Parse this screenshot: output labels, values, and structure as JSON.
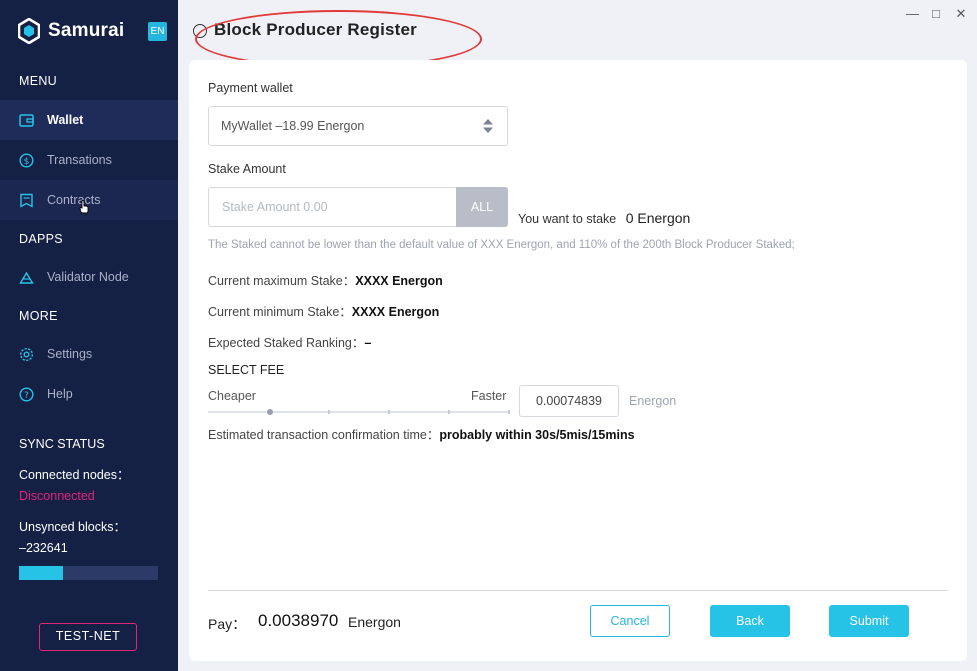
{
  "app": {
    "name": "Samurai",
    "lang": "EN"
  },
  "sidebar": {
    "menu_title": "MENU",
    "menu_items": [
      {
        "label": "Wallet",
        "icon": "wallet-icon"
      },
      {
        "label": "Transations",
        "icon": "dollar-circle-icon"
      },
      {
        "label": "Contracts",
        "icon": "contract-icon"
      }
    ],
    "dapps_title": "DAPPS",
    "dapps_items": [
      {
        "label": "Validator Node",
        "icon": "validator-icon"
      }
    ],
    "more_title": "MORE",
    "more_items": [
      {
        "label": "Settings",
        "icon": "gear-icon"
      },
      {
        "label": "Help",
        "icon": "help-icon"
      }
    ],
    "sync": {
      "title": "SYNC STATUS",
      "connected_label": "Connected nodes：",
      "connected_value": "Disconnected",
      "unsynced_label": "Unsynced blocks：",
      "unsynced_value": "–232641",
      "progress": 0.32
    },
    "network_button": "TEST-NET"
  },
  "page": {
    "title": "Block Producer Register"
  },
  "form": {
    "payment_wallet_label": "Payment wallet",
    "wallet_select_value": "MyWallet –18.99 Energon",
    "stake_amount_label": "Stake Amount",
    "stake_placeholder": "Stake Amount 0.00",
    "all_button": "ALL",
    "want_to_stake_label": "You want to stake",
    "want_to_stake_value": "0 Energon",
    "hint": "The Staked cannot be lower than the default value of XXX Energon, and 110% of the 200th Block Producer Staked;",
    "max_stake_label": "Current maximum Stake：",
    "max_stake_value": "XXXX Energon",
    "min_stake_label": "Current minimum Stake：",
    "min_stake_value": "XXXX Energon",
    "ranking_label": "Expected Staked Ranking：",
    "ranking_value": "–",
    "select_fee_label": "SELECT FEE",
    "cheaper_label": "Cheaper",
    "faster_label": "Faster",
    "fee_slider_position": 0.2,
    "fee_value": "0.00074839",
    "fee_unit": "Energon",
    "est_time_label": "Estimated transaction confirmation time：",
    "est_time_value": "probably within 30s/5mis/15mins"
  },
  "footer": {
    "pay_label": "Pay：",
    "pay_amount": "0.0038970",
    "pay_unit": "Energon",
    "cancel_button": "Cancel",
    "back_button": "Back",
    "submit_button": "Submit"
  },
  "colors": {
    "sidebar_bg": "#152045",
    "accent": "#26c3e6",
    "disconnected": "#e2247a",
    "annotation": "#e03a3a"
  }
}
